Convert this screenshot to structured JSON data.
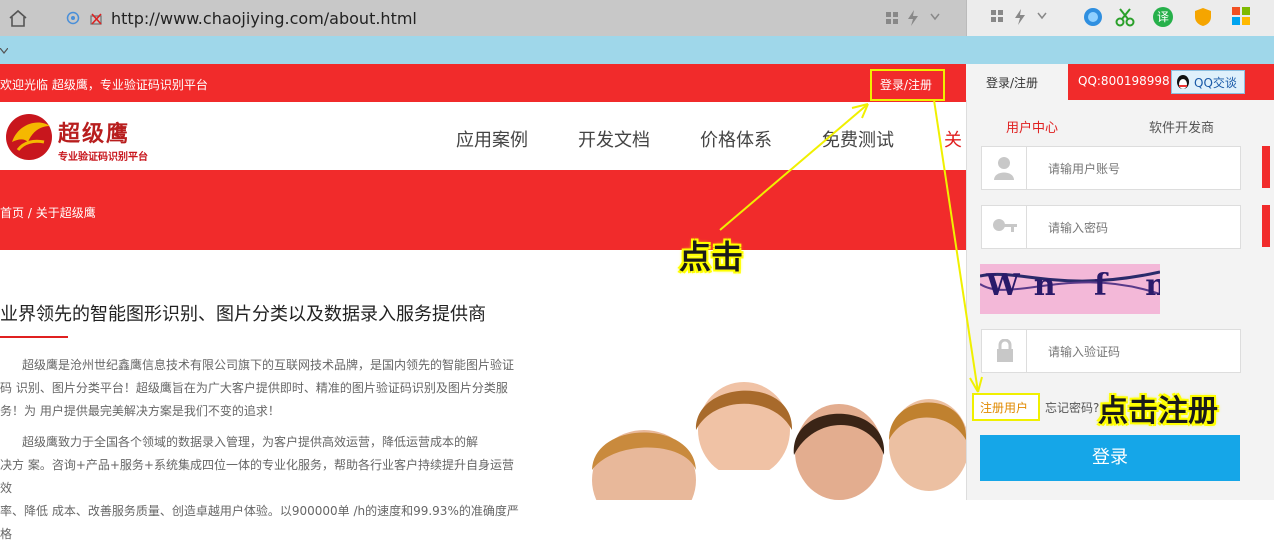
{
  "browser": {
    "url": "http://www.chaojiying.com/about.html",
    "extension_badge": "译"
  },
  "topbar": {
    "welcome": "欢迎光临 超级鹰，专业验证码识别平台",
    "login_register": "登录/注册"
  },
  "logo": {
    "name": "超级鹰",
    "tagline": "专业验证码识别平台"
  },
  "nav": {
    "items": [
      "应用案例",
      "开发文档",
      "价格体系",
      "免费测试",
      "关"
    ]
  },
  "breadcrumb": {
    "home": "首页",
    "separator": "/",
    "current": "关于超级鹰"
  },
  "content": {
    "heading": "业界领先的智能图形识别、图片分类以及数据录入服务提供商",
    "paragraphs": [
      [
        "超级鹰是沧州世纪鑫鹰信息技术有限公司旗下的互联网技术品牌，是国内领先的智能图片验证",
        "码 识别、图片分类平台！超级鹰旨在为广大客户提供即时、精准的图片验证码识别及图片分类服",
        "务！为 用户提供最完美解决方案是我们不变的追求！"
      ],
      [
        "超级鹰致力于全国各个领域的数据录入管理，为客户提供高效运营，降低运营成本的解",
        "决方 案。咨询+产品+服务+系统集成四位一体的专业化服务，帮助各行业客户持续提升自身运营效",
        "率、降低 成本、改善服务质量、创造卓越用户体验。以900000单 /h的速度和99.93%的准确度严格"
      ]
    ]
  },
  "panel": {
    "tab_login": "登录/注册",
    "qq_label": "QQ:800198998",
    "qq_chat": "QQ交谈",
    "tab_user_center": "用户中心",
    "tab_developer": "软件开发商",
    "username_placeholder": "请输用户账号",
    "password_placeholder": "请输入密码",
    "captcha_text": "Wn f m K",
    "captcha_placeholder": "请输入验证码",
    "register_link": "注册用户",
    "forgot_link": "忘记密码?",
    "login_button": "登录"
  },
  "annotations": {
    "click": "点击",
    "click_register": "点击注册"
  },
  "colors": {
    "brand_red": "#f12b2b",
    "login_blue": "#15a6e8",
    "highlight_yellow": "#f0f000"
  }
}
